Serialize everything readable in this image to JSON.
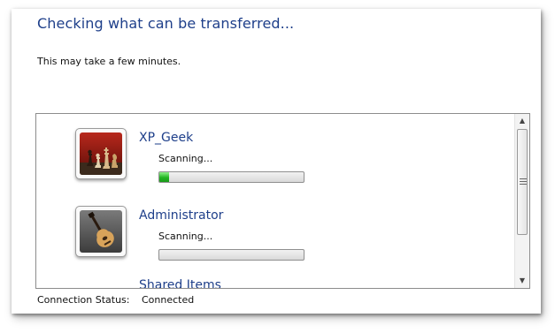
{
  "header": {
    "title": "Checking what can be transferred...",
    "subtitle": "This may take a few minutes."
  },
  "users": [
    {
      "name": "XP_Geek",
      "status": "Scanning...",
      "progress": 0.07,
      "icon": "chess-pieces-icon"
    },
    {
      "name": "Administrator",
      "status": "Scanning...",
      "progress": 0,
      "icon": "guitar-icon"
    }
  ],
  "partial_item": {
    "name": "Shared Items"
  },
  "footer": {
    "label": "Connection Status:",
    "value": "Connected"
  },
  "colors": {
    "accent": "#1e3f8a",
    "progress_green": "#22b522"
  }
}
